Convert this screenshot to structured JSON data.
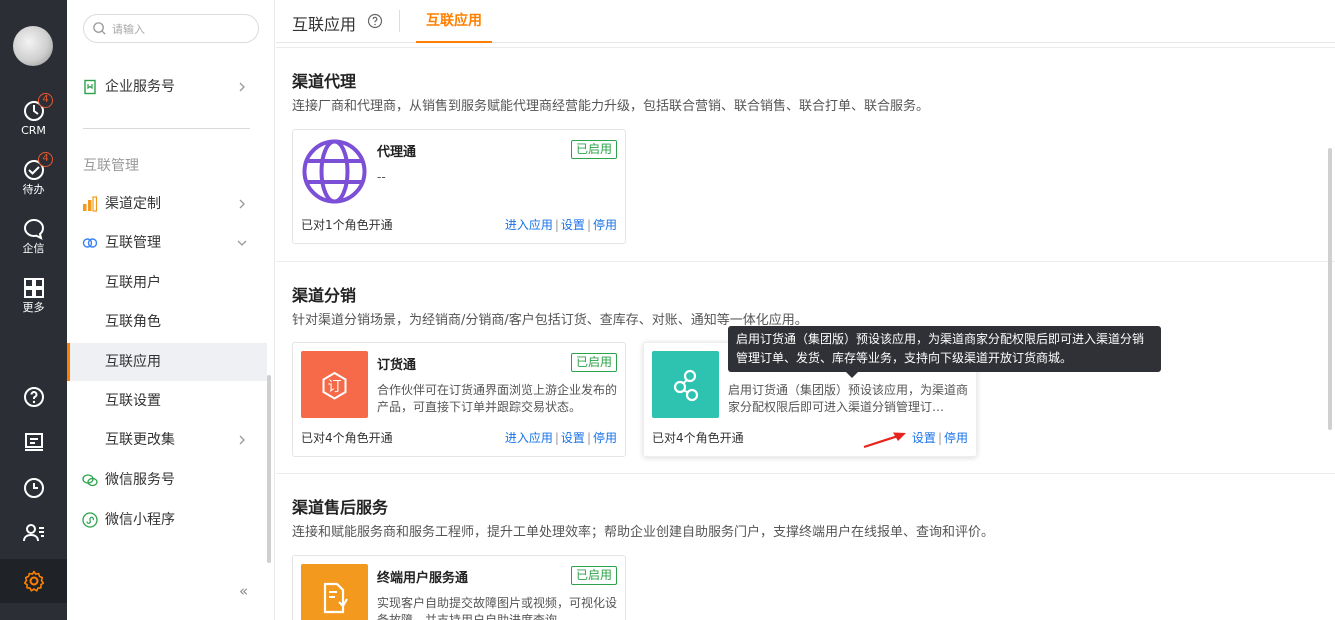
{
  "rail": {
    "items": [
      {
        "label": "CRM",
        "badge": "4",
        "icon": "crm-clock-icon"
      },
      {
        "label": "待办",
        "badge": "4",
        "icon": "check-circle-icon"
      },
      {
        "label": "企信",
        "icon": "chat-bubble-icon"
      },
      {
        "label": "更多",
        "icon": "grid-icon"
      }
    ],
    "bottom_icons": [
      "help-icon",
      "notice-icon",
      "history-icon",
      "contacts-icon",
      "settings-gear-icon"
    ],
    "accent": "#ff8000"
  },
  "sidebar": {
    "search_placeholder": "请输入",
    "enterprise_service": "企业服务号",
    "group_title": "互联管理",
    "channel_custom": "渠道定制",
    "interconnect_manage": "互联管理",
    "sub": {
      "users": "互联用户",
      "roles": "互联角色",
      "apps": "互联应用",
      "settings": "互联设置",
      "changeset": "互联更改集"
    },
    "wechat_service": "微信服务号",
    "wechat_mini": "微信小程序",
    "collapse": "«"
  },
  "header": {
    "title": "互联应用",
    "active_tab": "互联应用"
  },
  "sections": [
    {
      "title": "渠道代理",
      "desc": "连接厂商和代理商，从销售到服务赋能代理商经营能力升级，包括联合营销、联合销售、联合打单、联合服务。",
      "cards": [
        {
          "name": "代理通",
          "status": "已启用",
          "desc": "--",
          "foot": "已对1个角色开通",
          "links": [
            "进入应用",
            "设置",
            "停用"
          ],
          "color": "#7b4fd6"
        }
      ]
    },
    {
      "title": "渠道分销",
      "desc": "针对渠道分销场景，为经销商/分销商/客户包括订货、查库存、对账、通知等一体化应用。",
      "cards": [
        {
          "name": "订货通",
          "status": "已启用",
          "desc": "合作伙伴可在订货通界面浏览上游企业发布的产品，可直接下订单并跟踪交易状态。",
          "foot": "已对4个角色开通",
          "links": [
            "进入应用",
            "设置",
            "停用"
          ],
          "color": "#f66a4a"
        },
        {
          "name": "",
          "status": "",
          "desc": "启用订货通（集团版）预设该应用，为渠道商家分配权限后即可进入渠道分销管理订…",
          "foot": "已对4个角色开通",
          "links": [
            "设置",
            "停用"
          ],
          "color": "#2ec2b1"
        }
      ]
    },
    {
      "title": "渠道售后服务",
      "desc": "连接和赋能服务商和服务工程师，提升工单处理效率；帮助企业创建自助服务门户，支撑终端用户在线报单、查询和评价。",
      "cards": [
        {
          "name": "终端用户服务通",
          "status": "已启用",
          "desc": "实现客户自助提交故障图片或视频，可视化设备故障，并支持用户自助进度查询",
          "color": "#f39a1e"
        }
      ]
    }
  ],
  "tooltip": "启用订货通（集团版）预设该应用，为渠道商家分配权限后即可进入渠道分销管理订单、发货、库存等业务，支持向下级渠道开放订货商城。"
}
